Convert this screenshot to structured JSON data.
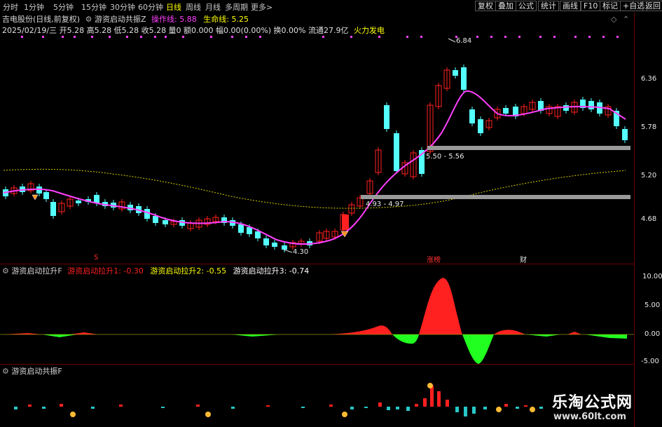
{
  "toolbar": {
    "timeframes": [
      "分时",
      "1分钟",
      "5分钟",
      "15分钟",
      "30分钟",
      "60分钟",
      "日线",
      "周线",
      "月线",
      "多周期",
      "更多>"
    ],
    "active_timeframe": "日线",
    "buttons": [
      "复权",
      "叠加",
      "公式",
      "统计",
      "画线",
      "F10",
      "标记",
      "+自选",
      "返回"
    ]
  },
  "main_panel": {
    "stock_name": "吉电股份(日线,前复权)",
    "indicator_name": "游资启动共振Z",
    "ops_line_label": "操作线:",
    "ops_line_value": "5.88",
    "life_line_label": "生命线:",
    "life_line_value": "5.25",
    "ohlc_text": "2025/02/19/三 开5.28 高5.28 低5.28 收5.28 量0 额0.000 幅0.00(0.00%) 换0.00% 流通27.9亿",
    "signal_text": "火力发电",
    "y_ticks": [
      "6.36",
      "5.78",
      "5.20",
      "4.68"
    ],
    "annotations": {
      "high": "6.84",
      "low": "4.30",
      "zone_upper": "5.50 - 5.56",
      "zone_lower": "4.93 - 4.97"
    },
    "markers": {
      "s": "S",
      "zhangbang": "涨榜",
      "cai": "财"
    },
    "colors": {
      "up": "#ff2020",
      "down": "#54ffff",
      "ma": "#ff40ff",
      "life": "#ffff00",
      "zone": "#9a9a9a"
    }
  },
  "panel2": {
    "name": "游资启动拉升F",
    "l1_label": "游资启动拉升1:",
    "l1_value": "-0.30",
    "l2_label": "游资启动拉升2:",
    "l2_value": "-0.55",
    "l3_label": "游资启动拉升3:",
    "l3_value": "-0.74",
    "y_ticks": [
      "10.00",
      "5.00",
      "0.00",
      "-5.00"
    ]
  },
  "panel3": {
    "name": "游资启动共振F"
  },
  "watermark": {
    "title": "乐淘公式网",
    "url": "www.60lt.com"
  }
}
